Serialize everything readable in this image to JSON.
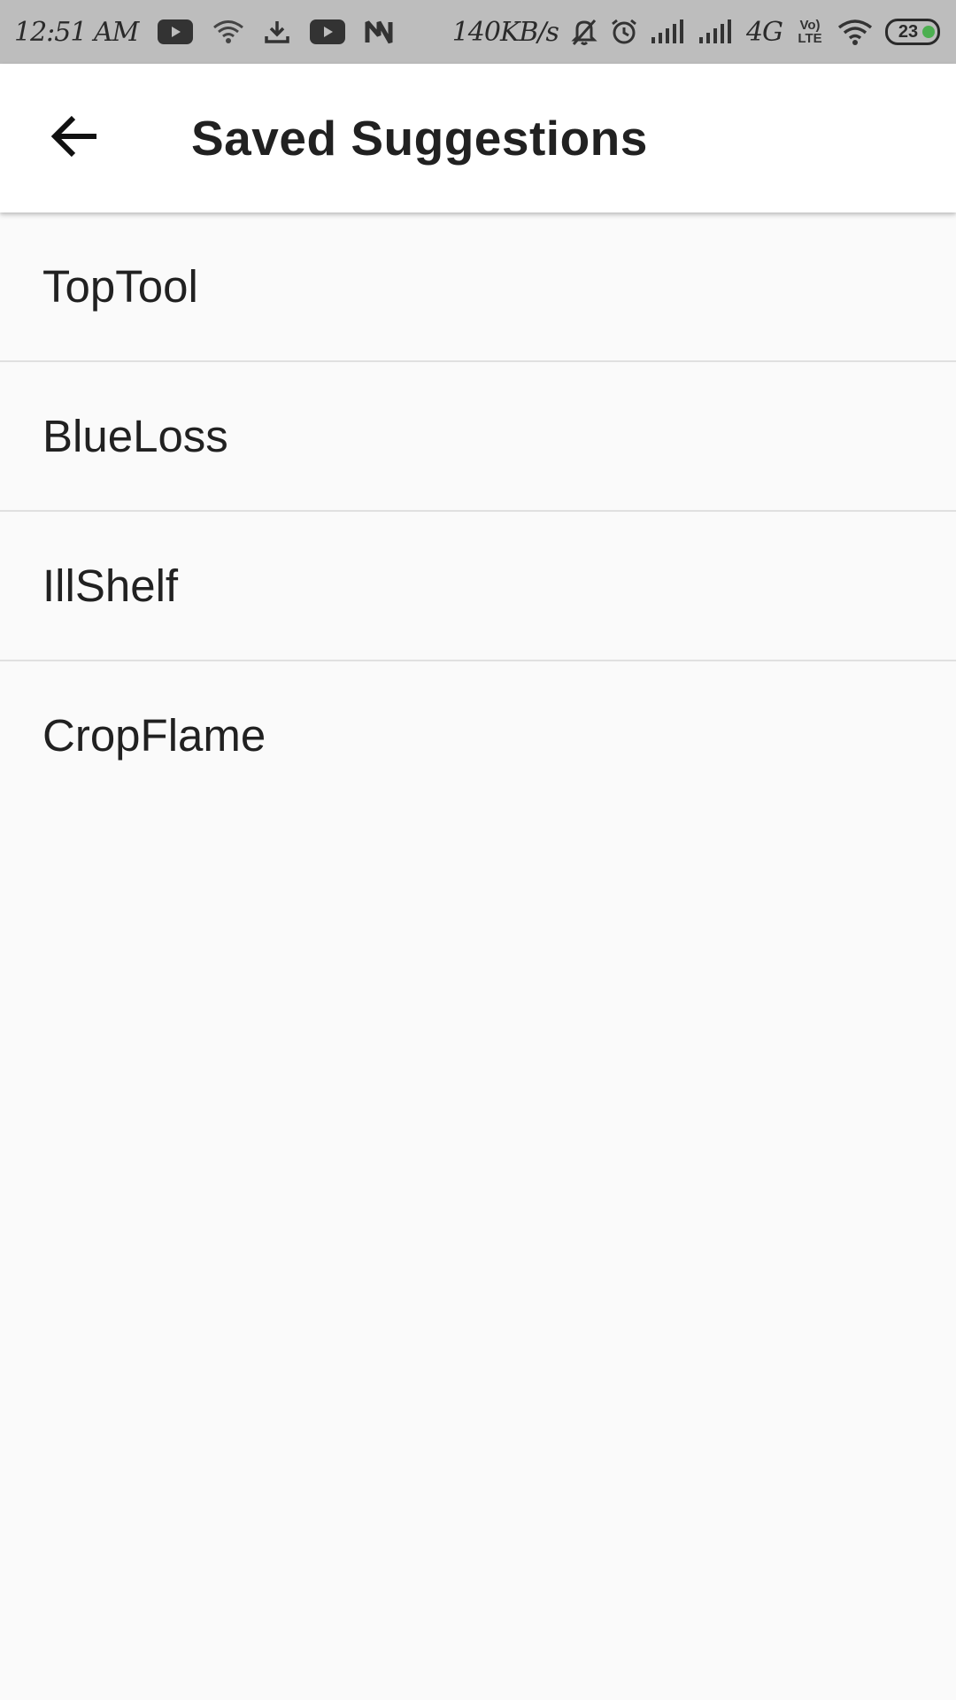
{
  "status_bar": {
    "time": "12:51 AM",
    "net_speed": "140KB/s",
    "network_type": "4G",
    "volte_label": "Vo) LTE",
    "battery": "23",
    "left_icons": [
      "youtube-icon",
      "wifi-icon",
      "download-icon",
      "youtube-icon",
      "n-app-icon"
    ],
    "right_icons": [
      "mute-bell-icon",
      "alarm-icon",
      "signal-icon",
      "signal-icon",
      "volte-icon",
      "wifi-icon",
      "battery-icon"
    ]
  },
  "app_bar": {
    "back_icon": "arrow-left-icon",
    "title": "Saved Suggestions"
  },
  "list": {
    "items": [
      {
        "label": "TopTool"
      },
      {
        "label": "BlueLoss"
      },
      {
        "label": "IllShelf"
      },
      {
        "label": "CropFlame"
      }
    ]
  },
  "colors": {
    "status_bar_bg": "#bdbdbd",
    "app_bar_bg": "#ffffff",
    "page_bg": "#fafafa",
    "divider": "#e0e0e0",
    "text_primary": "#212121",
    "battery_dot": "#4caf50"
  }
}
